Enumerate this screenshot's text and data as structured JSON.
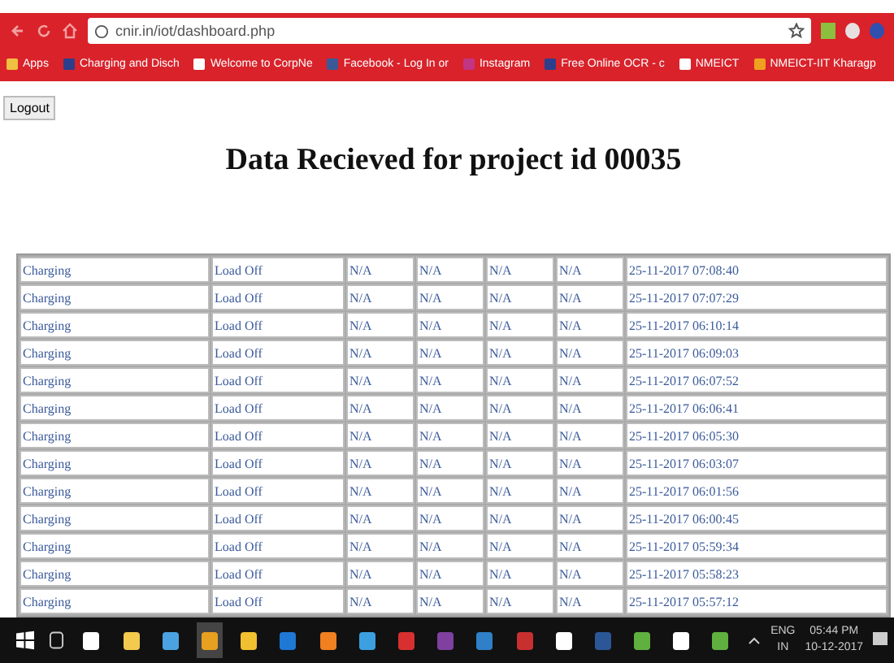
{
  "browser": {
    "address": "cnir.in/iot/dashboard.php",
    "bookmarks": [
      {
        "label": "Apps",
        "kind": "apps"
      },
      {
        "label": "Charging and Disch",
        "kind": "site"
      },
      {
        "label": "Welcome to CorpNe",
        "kind": "page"
      },
      {
        "label": "Facebook - Log In or",
        "kind": "facebook"
      },
      {
        "label": "Instagram",
        "kind": "instagram"
      },
      {
        "label": "Free Online OCR - c",
        "kind": "site"
      },
      {
        "label": "NMEICT",
        "kind": "page"
      },
      {
        "label": "NMEICT-IIT Kharagp",
        "kind": "chart"
      }
    ]
  },
  "logout_button": "Logout",
  "heading": "Data Recieved for project id 00035",
  "table": {
    "rows": [
      [
        "Charging",
        "Load Off",
        "N/A",
        "N/A",
        "N/A",
        "N/A",
        "25-11-2017 07:08:40"
      ],
      [
        "Charging",
        "Load Off",
        "N/A",
        "N/A",
        "N/A",
        "N/A",
        "25-11-2017 07:07:29"
      ],
      [
        "Charging",
        "Load Off",
        "N/A",
        "N/A",
        "N/A",
        "N/A",
        "25-11-2017 06:10:14"
      ],
      [
        "Charging",
        "Load Off",
        "N/A",
        "N/A",
        "N/A",
        "N/A",
        "25-11-2017 06:09:03"
      ],
      [
        "Charging",
        "Load Off",
        "N/A",
        "N/A",
        "N/A",
        "N/A",
        "25-11-2017 06:07:52"
      ],
      [
        "Charging",
        "Load Off",
        "N/A",
        "N/A",
        "N/A",
        "N/A",
        "25-11-2017 06:06:41"
      ],
      [
        "Charging",
        "Load Off",
        "N/A",
        "N/A",
        "N/A",
        "N/A",
        "25-11-2017 06:05:30"
      ],
      [
        "Charging",
        "Load Off",
        "N/A",
        "N/A",
        "N/A",
        "N/A",
        "25-11-2017 06:03:07"
      ],
      [
        "Charging",
        "Load Off",
        "N/A",
        "N/A",
        "N/A",
        "N/A",
        "25-11-2017 06:01:56"
      ],
      [
        "Charging",
        "Load Off",
        "N/A",
        "N/A",
        "N/A",
        "N/A",
        "25-11-2017 06:00:45"
      ],
      [
        "Charging",
        "Load Off",
        "N/A",
        "N/A",
        "N/A",
        "N/A",
        "25-11-2017 05:59:34"
      ],
      [
        "Charging",
        "Load Off",
        "N/A",
        "N/A",
        "N/A",
        "N/A",
        "25-11-2017 05:58:23"
      ],
      [
        "Charging",
        "Load Off",
        "N/A",
        "N/A",
        "N/A",
        "N/A",
        "25-11-2017 05:57:12"
      ]
    ]
  },
  "taskbar": {
    "language": "ENG",
    "region": "IN",
    "time": "05:44 PM",
    "date": "10-12-2017",
    "apps": [
      {
        "kind": "home",
        "selected": false
      },
      {
        "kind": "folder",
        "selected": false
      },
      {
        "kind": "computer",
        "selected": false
      },
      {
        "kind": "chrome",
        "selected": true
      },
      {
        "kind": "store",
        "selected": false
      },
      {
        "kind": "edge",
        "selected": false
      },
      {
        "kind": "cone",
        "selected": false
      },
      {
        "kind": "mail",
        "selected": false
      },
      {
        "kind": "download",
        "selected": false
      },
      {
        "kind": "purple",
        "selected": false
      },
      {
        "kind": "shield",
        "selected": false
      },
      {
        "kind": "red",
        "selected": false
      },
      {
        "kind": "doc",
        "selected": false
      },
      {
        "kind": "word",
        "selected": false
      },
      {
        "kind": "globe",
        "selected": false
      },
      {
        "kind": "doc",
        "selected": false
      },
      {
        "kind": "globe",
        "selected": false
      }
    ]
  }
}
